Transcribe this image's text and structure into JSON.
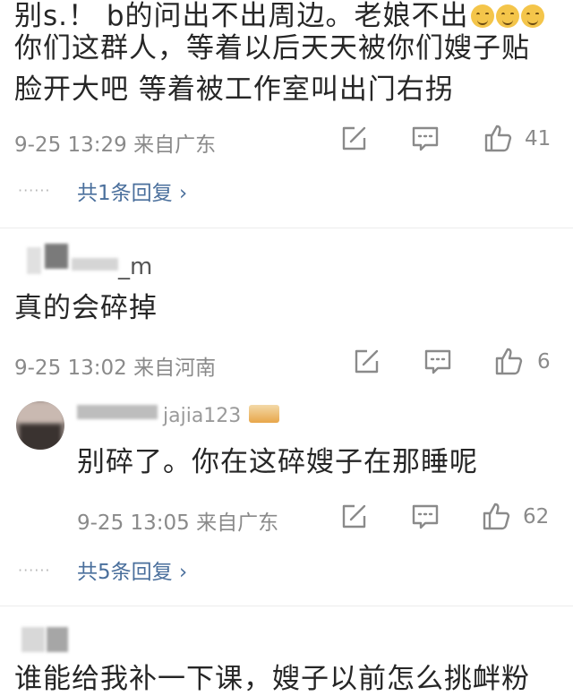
{
  "comments": [
    {
      "lines": [
        "别s.！ b的问出不出周边。老娘不出",
        "你们这群人，等着以后天天被你们嫂子贴",
        "脸开大吧 等着被工作室叫出门右拐"
      ],
      "emoji_count": 3,
      "meta": "9-25 13:29 来自广东",
      "likes": "41",
      "reply_link": "共1条回复 ›",
      "dots": "······"
    },
    {
      "username": "_m",
      "text": "真的会碎掉",
      "meta": "9-25 13:02 来自河南",
      "likes": "6"
    },
    {
      "username": "jajia123",
      "text": "别碎了。你在这碎嫂子在那睡呢",
      "meta": "9-25 13:05 来自广东",
      "likes": "62",
      "reply_link": "共5条回复 ›",
      "dots": "······"
    },
    {
      "text": "谁能给我补一下课，嫂子以前怎么挑衅粉"
    }
  ],
  "icons": {
    "share": "share-icon",
    "comment": "comment-icon",
    "like": "like-icon"
  }
}
